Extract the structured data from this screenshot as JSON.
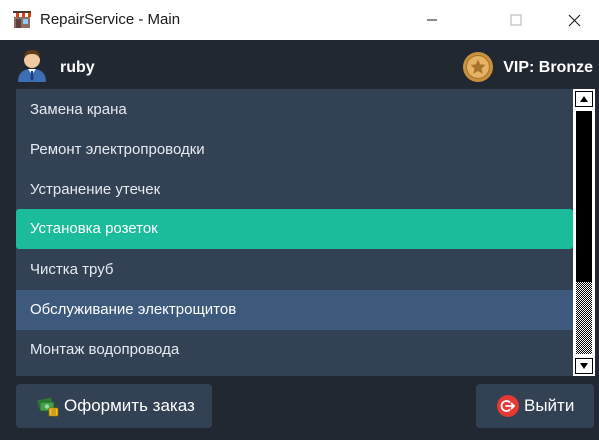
{
  "window": {
    "title": "RepairService - Main",
    "icon": "repair-shop-icon",
    "controls": [
      "minimize-icon",
      "maximize-icon",
      "close-icon"
    ]
  },
  "user": {
    "avatar": "user-avatar-icon",
    "name": "ruby"
  },
  "vip": {
    "badge": "star-medal-icon",
    "label": "VIP: Bronze"
  },
  "services": {
    "items": [
      {
        "label": "Замена крана",
        "state": "normal"
      },
      {
        "label": "Ремонт электропроводки",
        "state": "normal"
      },
      {
        "label": "Устранение утечек",
        "state": "normal"
      },
      {
        "label": "Установка розеток",
        "state": "selected"
      },
      {
        "label": "Чистка труб",
        "state": "normal"
      },
      {
        "label": "Обслуживание электрощитов",
        "state": "hover"
      },
      {
        "label": "Монтаж водопровода",
        "state": "normal"
      }
    ]
  },
  "actions": {
    "order_label": "Оформить заказ",
    "order_icon": "money-icon",
    "exit_label": "Выйти",
    "exit_icon": "logout-icon"
  },
  "colors": {
    "background": "#222831",
    "panel": "#334155",
    "selected": "#1abc9c",
    "hover": "#3d5a7d",
    "exit_icon": "#e53935",
    "vip_gold": "#c9913b"
  }
}
